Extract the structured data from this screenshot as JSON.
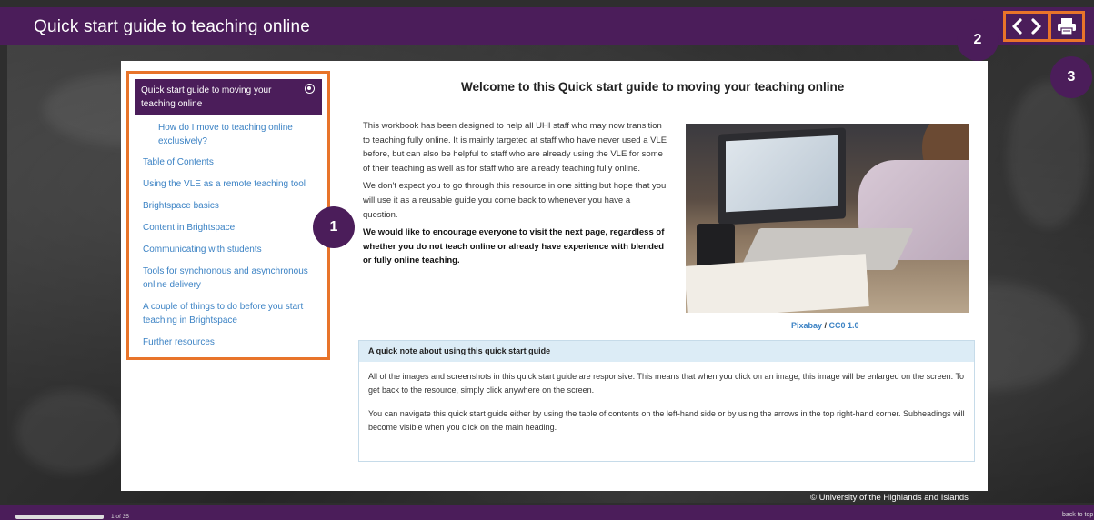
{
  "header": {
    "title": "Quick start guide to teaching online"
  },
  "callouts": {
    "one": "1",
    "two": "2",
    "three": "3"
  },
  "toc": {
    "active_label": "Quick start guide to moving your teaching online",
    "sub_item": "How do I move to teaching online exclusively?",
    "items": [
      "Table of Contents",
      "Using the VLE as a remote teaching tool",
      "Brightspace basics",
      "Content in Brightspace",
      "Communicating with students",
      "Tools for synchronous and asynchronous online delivery",
      "A couple of things to do before you start teaching in Brightspace",
      "Further resources"
    ]
  },
  "main": {
    "heading": "Welcome to this Quick start guide to moving your teaching online",
    "paragraphs": [
      "This workbook has been designed to help all UHI staff who may now transition to teaching fully online. It is mainly targeted at staff who have never used a VLE before, but can also be helpful to staff who are already using the VLE for some of their teaching as well as for staff who are already teaching fully online.",
      "We don't expect you to go through this resource in one sitting but hope that you will use it as a reusable guide you come back to whenever you have a question."
    ],
    "bold_paragraph": "We would like to encourage everyone to visit the next page, regardless of whether you do not teach online or already have experience with blended or fully online teaching.",
    "image_caption_source": "Pixabay",
    "image_caption_separator": " / ",
    "image_caption_license": "CC0 1.0"
  },
  "note": {
    "title": "A quick note about using this quick start guide",
    "paragraphs": [
      "All of the images and screenshots in this quick start guide are responsive. This means that when you click on an image, this image will be enlarged on the screen. To get back to the resource, simply click anywhere on the screen.",
      "You can navigate this quick start guide either by using the table of contents on the left-hand side or by using the arrows in the top right-hand corner.  Subheadings will become visible when you click on the main heading."
    ]
  },
  "footer": {
    "copyright": "© University of the Highlands and Islands",
    "page_count": "1 of 35",
    "back_to_top": "back to top",
    "progress": 0.03
  },
  "colors": {
    "brand_purple": "#4b1d5a",
    "highlight_orange": "#e8742a",
    "link_blue": "#3b82c4"
  },
  "icons": [
    "chevron-left-icon",
    "chevron-right-icon",
    "print-icon",
    "expand-icon"
  ]
}
